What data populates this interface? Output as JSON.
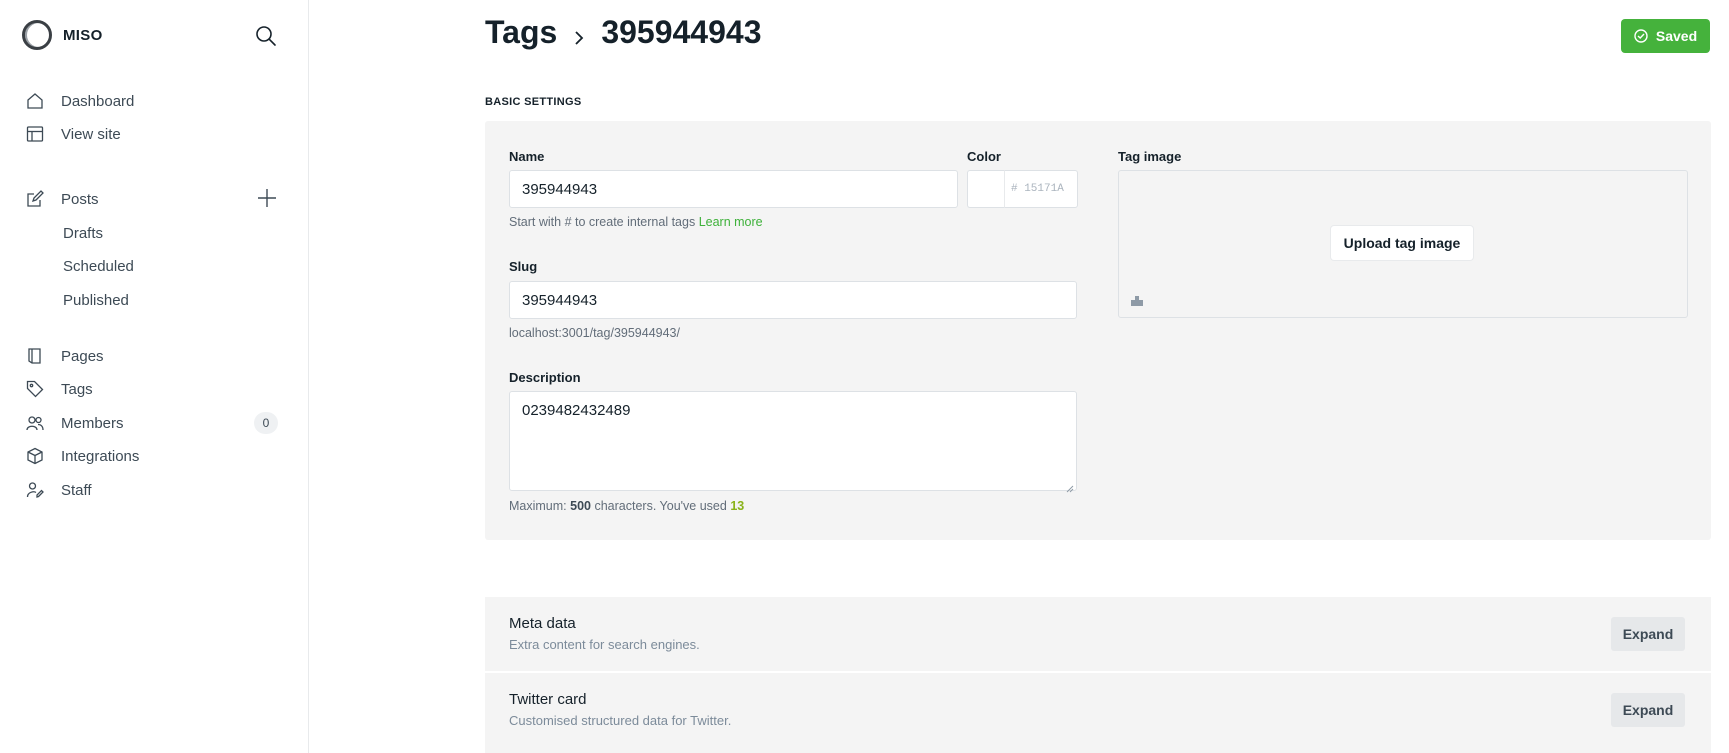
{
  "brand": {
    "name": "MISO",
    "logo_icon": "ring-logo"
  },
  "search": {
    "icon": "search-icon"
  },
  "nav": {
    "dashboard": "Dashboard",
    "view_site": "View site",
    "posts": "Posts",
    "drafts": "Drafts",
    "scheduled": "Scheduled",
    "published": "Published",
    "pages": "Pages",
    "tags": "Tags",
    "members": "Members",
    "members_count": "0",
    "integrations": "Integrations",
    "staff": "Staff"
  },
  "header": {
    "breadcrumb_root": "Tags",
    "breadcrumb_current": "395944943",
    "saved_label": "Saved",
    "saved_color": "#45b23c"
  },
  "basic": {
    "section_label": "BASIC SETTINGS",
    "name_label": "Name",
    "name_value": "395944943",
    "name_hint": "Start with # to create internal tags",
    "name_hint_link": "Learn more",
    "color_label": "Color",
    "color_value": "# 15171A",
    "slug_label": "Slug",
    "slug_value": "395944943",
    "slug_url": "localhost:3001/tag/395944943/",
    "description_label": "Description",
    "description_value": "0239482432489",
    "desc_hint_prefix": "Maximum:",
    "desc_hint_max": "500",
    "desc_hint_mid": "characters. You've used",
    "desc_hint_used": "13",
    "tag_image_label": "Tag image",
    "upload_label": "Upload tag image"
  },
  "sections": [
    {
      "title": "Meta data",
      "description": "Extra content for search engines.",
      "button": "Expand"
    },
    {
      "title": "Twitter card",
      "description": "Customised structured data for Twitter.",
      "button": "Expand"
    }
  ]
}
